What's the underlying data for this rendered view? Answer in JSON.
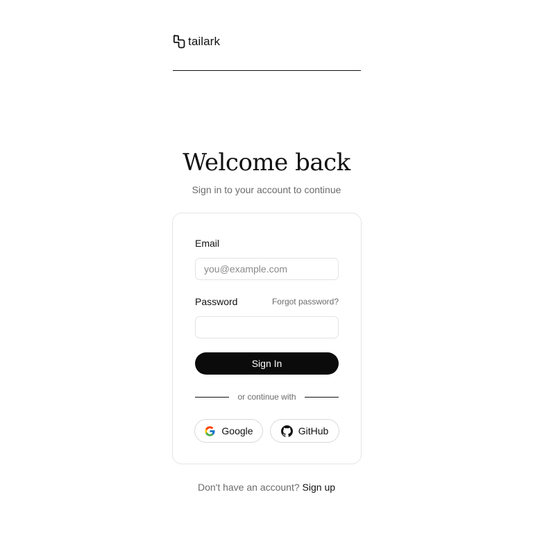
{
  "brand": {
    "name": "tailark"
  },
  "heading": {
    "title": "Welcome back",
    "subtitle": "Sign in to your account to continue"
  },
  "form": {
    "email_label": "Email",
    "email_placeholder": "you@example.com",
    "email_value": "",
    "password_label": "Password",
    "password_value": "",
    "forgot_label": "Forgot password?",
    "submit_label": "Sign In",
    "divider_label": "or continue with"
  },
  "social": {
    "google_label": "Google",
    "github_label": "GitHub"
  },
  "footer": {
    "prompt": "Don't have an account?",
    "signup_label": "Sign up"
  },
  "colors": {
    "primary": "#0b0b0b",
    "muted_text": "#6b6b6b",
    "border": "#e5e5e5"
  },
  "icons": [
    "tailark-logo-icon",
    "google-icon",
    "github-icon"
  ]
}
